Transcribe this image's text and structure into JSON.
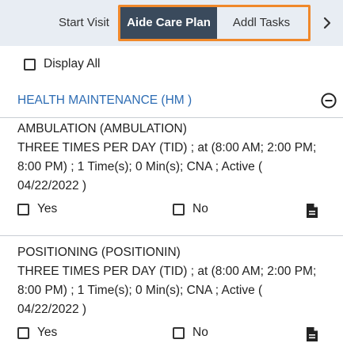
{
  "tabs": {
    "start_visit": "Start Visit",
    "aide_care_plan": "Aide Care Plan",
    "addl_tasks": "Addl Tasks",
    "next_label": "›"
  },
  "display_all": {
    "label": "Display All",
    "checked": false
  },
  "section": {
    "title": "HEALTH MAINTENANCE (HM )",
    "collapse_icon": "minus-circle-icon"
  },
  "tasks": [
    {
      "name": "AMBULATION (AMBULATION)",
      "details_line1": "THREE TIMES PER DAY (TID) ; at (8:00 AM; 2:00 PM;",
      "details_line2": "8:00 PM) ; 1 Time(s); 0 Min(s); CNA ; Active (",
      "details_line3": "04/22/2022 )",
      "yes_label": "Yes",
      "no_label": "No",
      "doc_icon": "document-icon"
    },
    {
      "name": "POSITIONING (POSITIONIN)",
      "details_line1": "THREE TIMES PER DAY (TID) ; at (8:00 AM; 2:00 PM;",
      "details_line2": "8:00 PM) ; 1 Time(s); 0 Min(s); CNA ; Active (",
      "details_line3": "04/22/2022 )",
      "yes_label": "Yes",
      "no_label": "No",
      "doc_icon": "document-icon"
    }
  ],
  "colors": {
    "active_tab_bg": "#3a4a5c",
    "highlight_border": "#f0882a",
    "section_title": "#2e6db4",
    "tabbar_bg": "#e8edf3"
  }
}
